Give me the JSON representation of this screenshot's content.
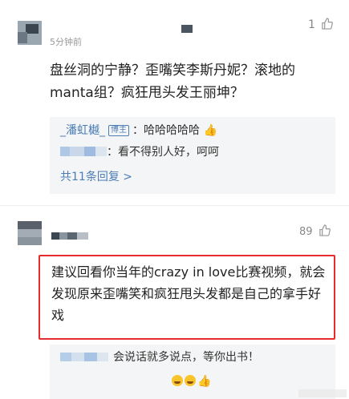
{
  "comment1": {
    "time": "5分钟前",
    "likes": "1",
    "text": "盘丝洞的宁静？歪嘴笑李斯丹妮？滚地的manta组？疯狂甩头发王丽坤？",
    "replies": [
      {
        "user": "_潘虹樾_",
        "badge": "博主",
        "text": "：哈哈哈哈哈"
      },
      {
        "text": "：看不得别人好，呵呵"
      }
    ],
    "more": "共11条回复 >"
  },
  "comment2": {
    "likes": "89",
    "text": "建议回看你当年的crazy in love比赛视频，就会发现原来歪嘴笑和疯狂甩头发都是自己的拿手好戏",
    "reply": {
      "text": "会说话就多说点，等你出书！"
    }
  },
  "icons": {
    "like": "thumbs-up-icon",
    "reply_emoji": "thumbs-up-emoji-icon",
    "laugh": "laugh-emoji-icon"
  },
  "colors": {
    "link": "#4a7db5",
    "highlight": "#e52b2b",
    "reply_bg": "#f4f5f6"
  }
}
